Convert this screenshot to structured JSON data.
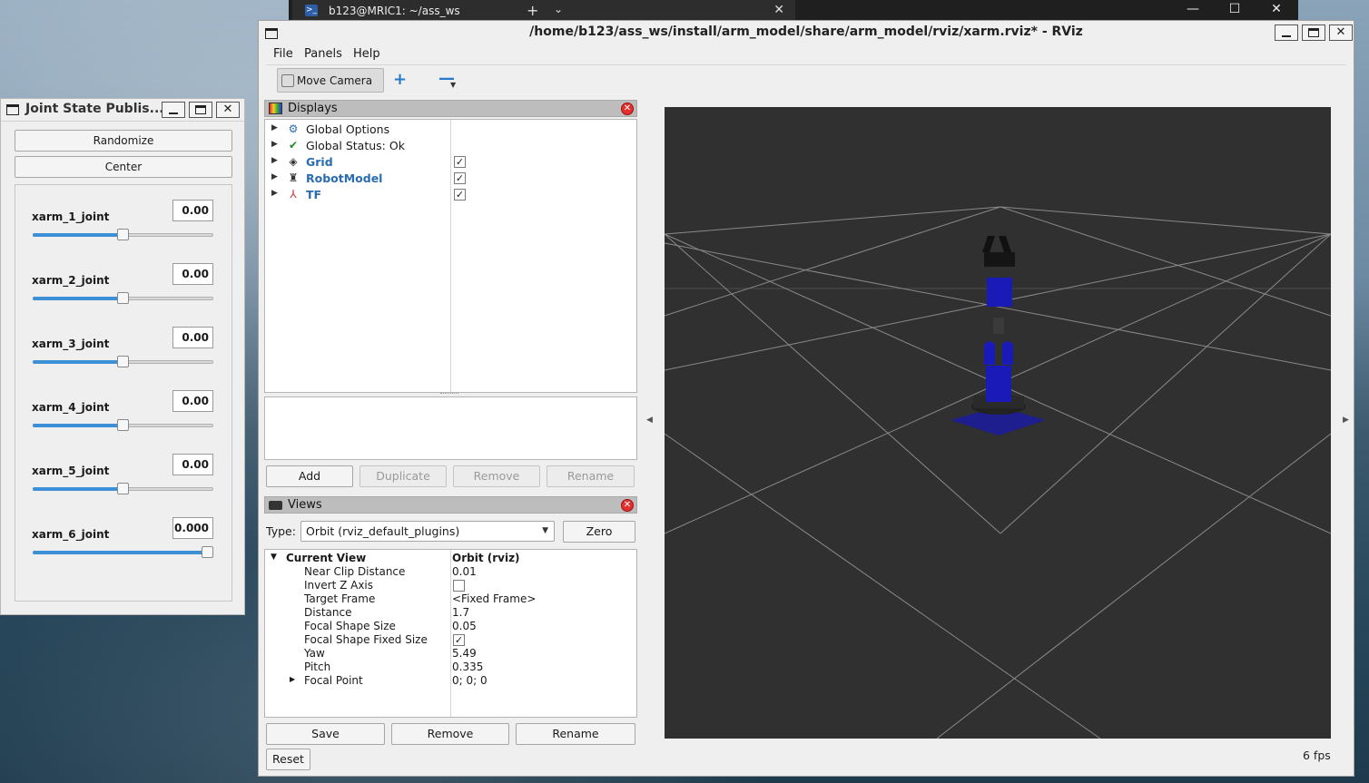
{
  "terminal": {
    "tab_title": "b123@MRIC1: ~/ass_ws",
    "close_glyph": "✕",
    "new_tab_glyph": "+",
    "dropdown_glyph": "⌄",
    "minimize_glyph": "—",
    "maximize_glyph": "☐",
    "close_window_glyph": "✕"
  },
  "joint_state_publisher": {
    "title": "Joint State Publis...",
    "randomize_label": "Randomize",
    "center_label": "Center",
    "joints": [
      {
        "name": "xarm_1_joint",
        "value": "0.00",
        "level": 0.5
      },
      {
        "name": "xarm_2_joint",
        "value": "0.00",
        "level": 0.5
      },
      {
        "name": "xarm_3_joint",
        "value": "0.00",
        "level": 0.5
      },
      {
        "name": "xarm_4_joint",
        "value": "0.00",
        "level": 0.5
      },
      {
        "name": "xarm_5_joint",
        "value": "0.00",
        "level": 0.5
      },
      {
        "name": "xarm_6_joint",
        "value": "0.000",
        "level": 1.0
      }
    ]
  },
  "rviz": {
    "title": "/home/b123/ass_ws/install/arm_model/share/arm_model/rviz/xarm.rviz* - RViz",
    "menu": {
      "file": "File",
      "panels": "Panels",
      "help": "Help"
    },
    "toolbar": {
      "move_camera": "Move Camera",
      "add_tool_glyph": "+",
      "remove_tool_glyph": "—"
    },
    "displays": {
      "title": "Displays",
      "items": [
        {
          "label": "Global Options",
          "icon": "gear-icon",
          "checkbox": false,
          "checked": false,
          "highlight": false
        },
        {
          "label": "Global Status: Ok",
          "icon": "checkmark-icon",
          "checkbox": false,
          "checked": false,
          "highlight": false
        },
        {
          "label": "Grid",
          "icon": "grid-icon",
          "checkbox": true,
          "checked": true,
          "highlight": true
        },
        {
          "label": "RobotModel",
          "icon": "robot-icon",
          "checkbox": true,
          "checked": true,
          "highlight": true
        },
        {
          "label": "TF",
          "icon": "axes-icon",
          "checkbox": true,
          "checked": true,
          "highlight": true
        }
      ],
      "buttons": {
        "add": "Add",
        "duplicate": "Duplicate",
        "remove": "Remove",
        "rename": "Rename"
      }
    },
    "views": {
      "title": "Views",
      "type_label": "Type:",
      "type_value": "Orbit (rviz_default_plugins)",
      "zero_label": "Zero",
      "current_view": {
        "label": "Current View",
        "value": "Orbit (rviz)"
      },
      "properties": [
        {
          "label": "Near Clip Distance",
          "value": "0.01"
        },
        {
          "label": "Invert Z Axis",
          "value": "",
          "checkbox": true,
          "checked": false
        },
        {
          "label": "Target Frame",
          "value": "<Fixed Frame>"
        },
        {
          "label": "Distance",
          "value": "1.7"
        },
        {
          "label": "Focal Shape Size",
          "value": "0.05"
        },
        {
          "label": "Focal Shape Fixed Size",
          "value": "",
          "checkbox": true,
          "checked": true
        },
        {
          "label": "Yaw",
          "value": "5.49"
        },
        {
          "label": "Pitch",
          "value": "0.335"
        },
        {
          "label": "Focal Point",
          "value": "0; 0; 0",
          "expandable": true
        }
      ],
      "buttons": {
        "save": "Save",
        "remove": "Remove",
        "rename": "Rename"
      },
      "reset_label": "Reset"
    },
    "fps": "6 fps",
    "colors": {
      "viewport_bg": "#303030",
      "grid_line": "#8a8a8a",
      "robot_blue": "#1a1aa8",
      "highlight_blue": "#2a6cb0",
      "slider_fill": "#3d8fd6"
    }
  }
}
